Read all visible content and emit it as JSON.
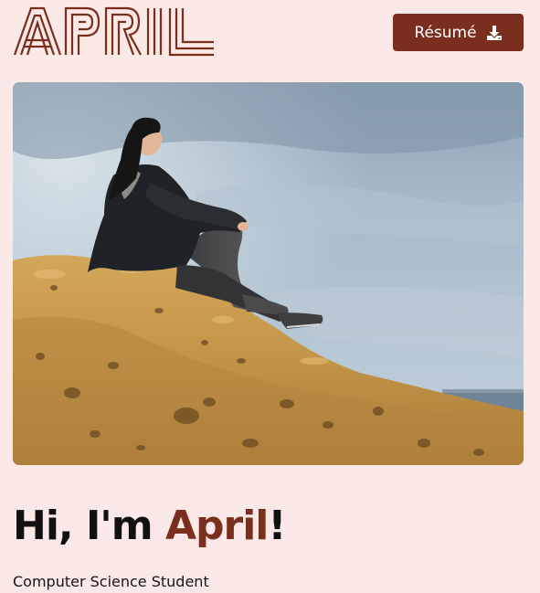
{
  "header": {
    "logo_text": "APRIL",
    "resume_button_label": "Résumé",
    "resume_icon": "download-icon"
  },
  "hero": {
    "photo_alt": "Person sitting on a rock cliff by the sea"
  },
  "intro": {
    "greeting_prefix": "Hi, I'm ",
    "greeting_name": "April",
    "greeting_suffix": "!",
    "subtitle": "Computer Science Student"
  },
  "colors": {
    "background": "#fae9e6",
    "accent": "#7a2e1d",
    "text": "#111111"
  }
}
